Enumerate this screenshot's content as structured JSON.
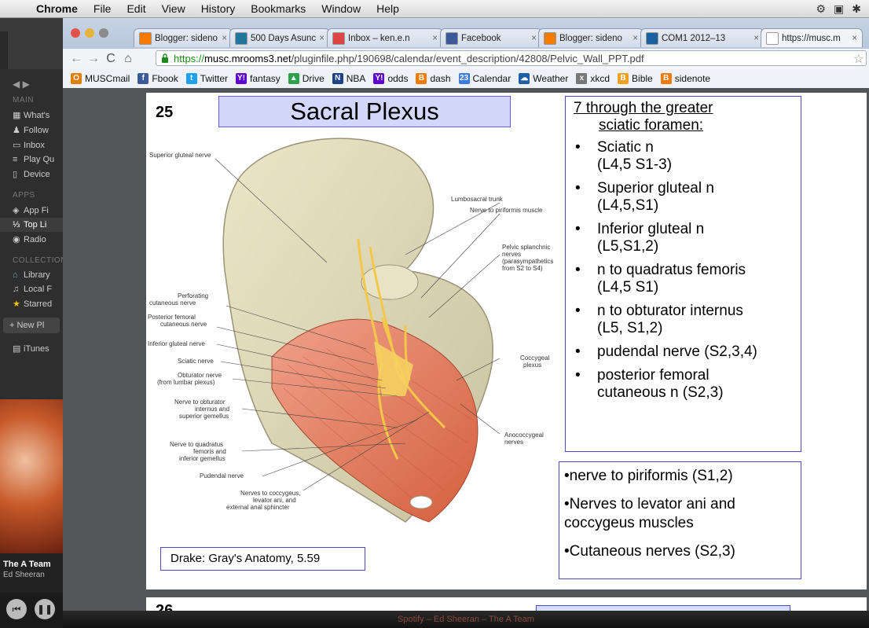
{
  "menubar": {
    "app": "Chrome",
    "items": [
      "File",
      "Edit",
      "View",
      "History",
      "Bookmarks",
      "Window",
      "Help"
    ]
  },
  "tabs": [
    {
      "label": "Blogger: sideno",
      "icon": "blogger-icon",
      "color": "#f57c00"
    },
    {
      "label": "500 Days Asunc",
      "icon": "wordpress-icon",
      "color": "#21759b"
    },
    {
      "label": "Inbox – ken.e.n",
      "icon": "gmail-icon",
      "color": "#d44"
    },
    {
      "label": "Facebook",
      "icon": "facebook-icon",
      "color": "#3b5998"
    },
    {
      "label": "Blogger: sideno",
      "icon": "blogger-icon",
      "color": "#f57c00"
    },
    {
      "label": "COM1 2012–13",
      "icon": "course-icon",
      "color": "#1a5fa0"
    },
    {
      "label": "https://musc.m",
      "icon": "page-icon",
      "color": "#ffffff"
    }
  ],
  "url": {
    "scheme": "https://",
    "host": "musc.mrooms3.net",
    "path": "/pluginfile.php/190698/calendar/event_description/42808/Pelvic_Wall_PPT.pdf"
  },
  "bookmarks": [
    {
      "label": "MUSCmail",
      "icon": "outlook-icon",
      "color": "#e67e00",
      "glyph": "O"
    },
    {
      "label": "Fbook",
      "icon": "facebook-icon",
      "color": "#3b5998",
      "glyph": "f"
    },
    {
      "label": "Twitter",
      "icon": "twitter-icon",
      "color": "#1da1f2",
      "glyph": "t"
    },
    {
      "label": "fantasy",
      "icon": "yahoo-icon",
      "color": "#5f01d1",
      "glyph": "Y!"
    },
    {
      "label": "Drive",
      "icon": "drive-icon",
      "color": "#2aa34a",
      "glyph": "▲"
    },
    {
      "label": "NBA",
      "icon": "nba-icon",
      "color": "#1d428a",
      "glyph": "N"
    },
    {
      "label": "odds",
      "icon": "yahoo-icon",
      "color": "#5f01d1",
      "glyph": "Y!"
    },
    {
      "label": "dash",
      "icon": "blogger-icon",
      "color": "#f57c00",
      "glyph": "B"
    },
    {
      "label": "Calendar",
      "icon": "calendar-icon",
      "color": "#3d7be0",
      "glyph": "23"
    },
    {
      "label": "Weather",
      "icon": "weather-icon",
      "color": "#1e5fa8",
      "glyph": "☁"
    },
    {
      "label": "xkcd",
      "icon": "xkcd-icon",
      "color": "#777777",
      "glyph": "x"
    },
    {
      "label": "Bible",
      "icon": "bible-icon",
      "color": "#f0a020",
      "glyph": "B"
    },
    {
      "label": "sidenote",
      "icon": "blogger-icon",
      "color": "#f57c00",
      "glyph": "B"
    }
  ],
  "spotify": {
    "main_header": "MAIN",
    "main_items": [
      "What's",
      "Follow",
      "Inbox",
      "Play Qu",
      "Device"
    ],
    "apps_header": "APPS",
    "apps_items": [
      "App Fi",
      "Top Li",
      "Radio"
    ],
    "collection_header": "COLLECTION",
    "collection_items": [
      "Library",
      "Local F",
      "Starred"
    ],
    "new_playlist": "+ New Pl",
    "itunes": "iTunes",
    "track": "The A Team",
    "artist": "Ed Sheeran"
  },
  "slide": {
    "number": "25",
    "title": "Sacral Plexus",
    "box_heading_line1": "7 through the greater",
    "box_heading_line2": "sciatic foramen:",
    "nerves": [
      {
        "line1": "Sciatic n",
        "line2": "(L4,5 S1-3)"
      },
      {
        "line1": "Superior gluteal n",
        "line2": "(L4,5,S1)"
      },
      {
        "line1": "Inferior gluteal n",
        "line2": "(L5,S1,2)"
      },
      {
        "line1": "n to quadratus femoris",
        "line2": "(L4,5 S1)"
      },
      {
        "line1": "n to obturator internus",
        "line2": "(L5, S1,2)"
      },
      {
        "line1": "pudendal nerve (S2,3,4)",
        "line2": ""
      },
      {
        "line1": "posterior femoral",
        "line2": "cutaneous n (S2,3)"
      }
    ],
    "other": [
      "•nerve to piriformis (S1,2)",
      "•Nerves to levator ani and coccygeus muscles",
      "•Cutaneous nerves (S2,3)"
    ],
    "credit": "Drake: Gray's Anatomy, 5.59",
    "figure_labels": {
      "superior_gluteal": "Superior gluteal nerve",
      "lumbosacral": "Lumbosacral trunk",
      "piriformis": "Nerve to piriformis muscle",
      "pelvic_splanchnic": [
        "Pelvic splanchnic",
        "nerves",
        "(parasympathetics",
        "from S2 to S4)"
      ],
      "perforating": [
        "Perforating",
        "cutaneous nerve"
      ],
      "post_femoral": [
        "Posterior femoral",
        "cutaneous nerve"
      ],
      "inf_gluteal": "Inferior gluteal nerve",
      "sciatic": "Sciatic nerve",
      "obturator": [
        "Obturator nerve",
        "(from lumbar plexus)"
      ],
      "obt_internus": [
        "Nerve to obturator",
        "internus and",
        "superior gemellus"
      ],
      "quadratus": [
        "Nerve to quadratus",
        "femoris and",
        "inferior gemellus"
      ],
      "pudendal": "Pudendal nerve",
      "coccygeus": [
        "Nerves to coccygeus,",
        "levator ani, and",
        "external anal sphincter"
      ],
      "coccygeal_plexus": [
        "Coccygeal",
        "plexus"
      ],
      "anococcygeal": [
        "Anococcygeal",
        "nerves"
      ]
    }
  },
  "page2_number": "26",
  "dock_caption": "Spotify – Ed Sheeran – The A Team"
}
